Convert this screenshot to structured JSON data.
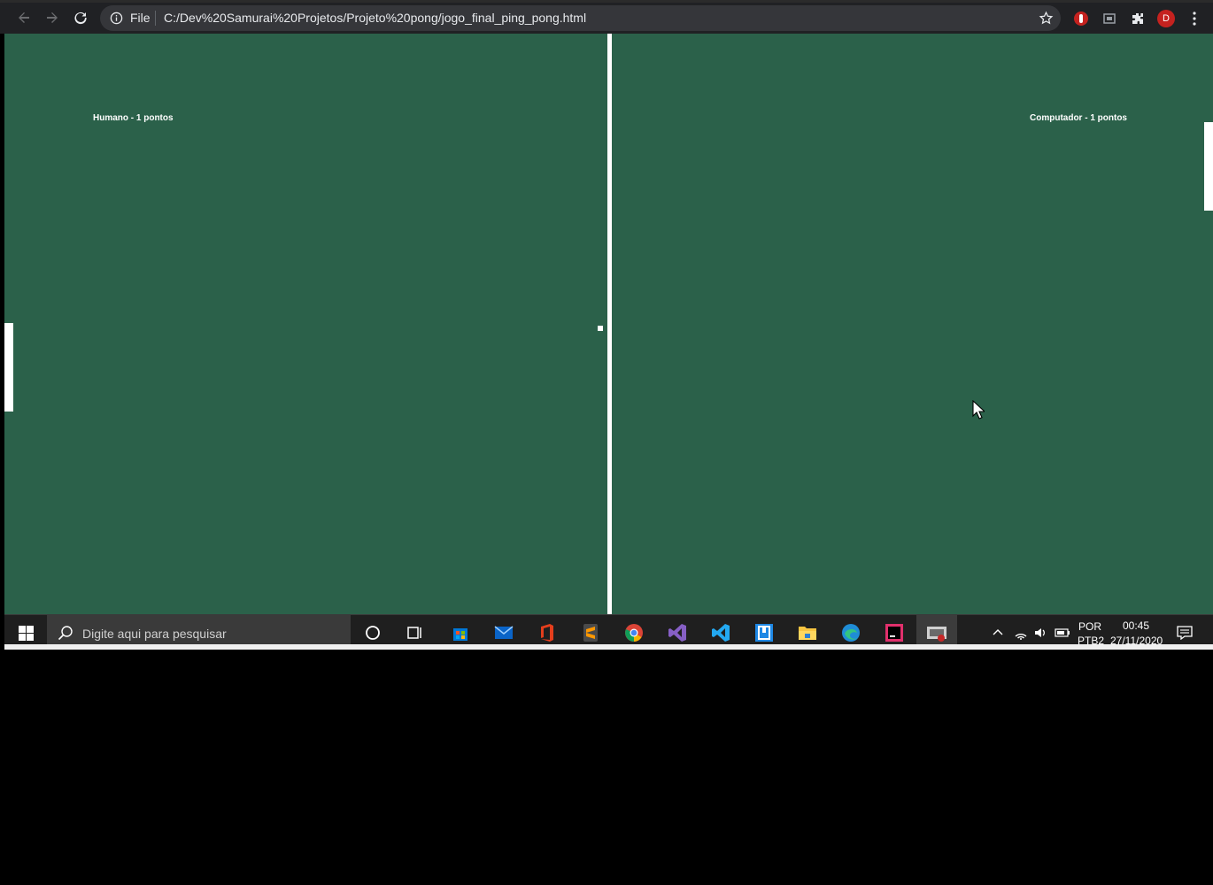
{
  "browser": {
    "nav": {
      "back_icon": "back-arrow-icon",
      "forward_icon": "forward-arrow-icon",
      "reload_icon": "reload-icon"
    },
    "address_bar": {
      "scheme_label": "File",
      "url": "C:/Dev%20Samurai%20Projetos/Projeto%20pong/jogo_final_ping_pong.html"
    },
    "profile_initial": "D"
  },
  "game": {
    "background_color": "#2b614a",
    "score_left": "Humano - 1 pontos",
    "score_right": "Computador - 1 pontos"
  },
  "taskbar": {
    "search_placeholder": "Digite aqui para pesquisar",
    "language_top": "POR",
    "language_bottom": "PTB2",
    "time": "00:45",
    "date": "27/11/2020"
  }
}
